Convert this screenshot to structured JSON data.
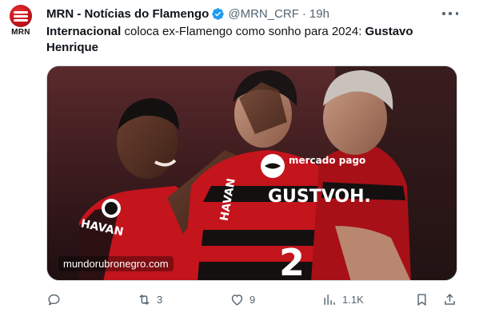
{
  "account": {
    "avatar_text": "MRN",
    "display_name": "MRN - Notícias do Flamengo",
    "handle": "@MRN_CRF",
    "separator": "·",
    "time": "19h"
  },
  "tweet": {
    "text_bold_1": "Internacional",
    "text_mid": " coloca ex-Flamengo como sonho para 2024: ",
    "text_bold_2": "Gustavo Henrique"
  },
  "media": {
    "watermark": "mundorubronegro.com",
    "jersey_sponsor": "mercado pago",
    "jersey_name": "GUSTVOH.",
    "jersey_number": "2",
    "sleeve_text": "HAVAN"
  },
  "actions": {
    "reply_count": "",
    "retweet_count": "3",
    "like_count": "9",
    "views_count": "1.1K"
  },
  "colors": {
    "verified": "#1d9bf0",
    "text_secondary": "#536471",
    "flamengo_red": "#c4141c"
  },
  "icons": [
    "verified-badge-icon",
    "more-icon",
    "reply-icon",
    "retweet-icon",
    "like-icon",
    "views-icon",
    "bookmark-icon",
    "share-icon"
  ]
}
